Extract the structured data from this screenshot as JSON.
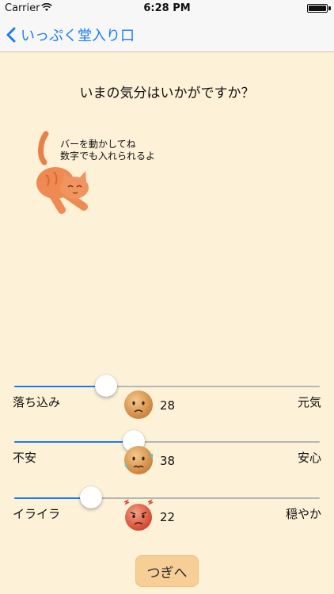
{
  "status_bar": {
    "carrier": "Carrier",
    "time": "6:28 PM"
  },
  "nav": {
    "back_label": "いっぷく堂入り口"
  },
  "question": "いまの気分はいかがですか？",
  "hint": {
    "line1": "バーを動かしてね",
    "line2": "数字でも入れられるよ"
  },
  "sliders": [
    {
      "left_label": "落ち込み",
      "right_label": "元気",
      "value": "28"
    },
    {
      "left_label": "不安",
      "right_label": "安心",
      "value": "38"
    },
    {
      "left_label": "イライラ",
      "right_label": "穏やか",
      "value": "22"
    }
  ],
  "next_label": "つぎへ",
  "colors": {
    "accent": "#1a7cf5",
    "background": "#fdf1d8",
    "button": "#f7cf96"
  }
}
